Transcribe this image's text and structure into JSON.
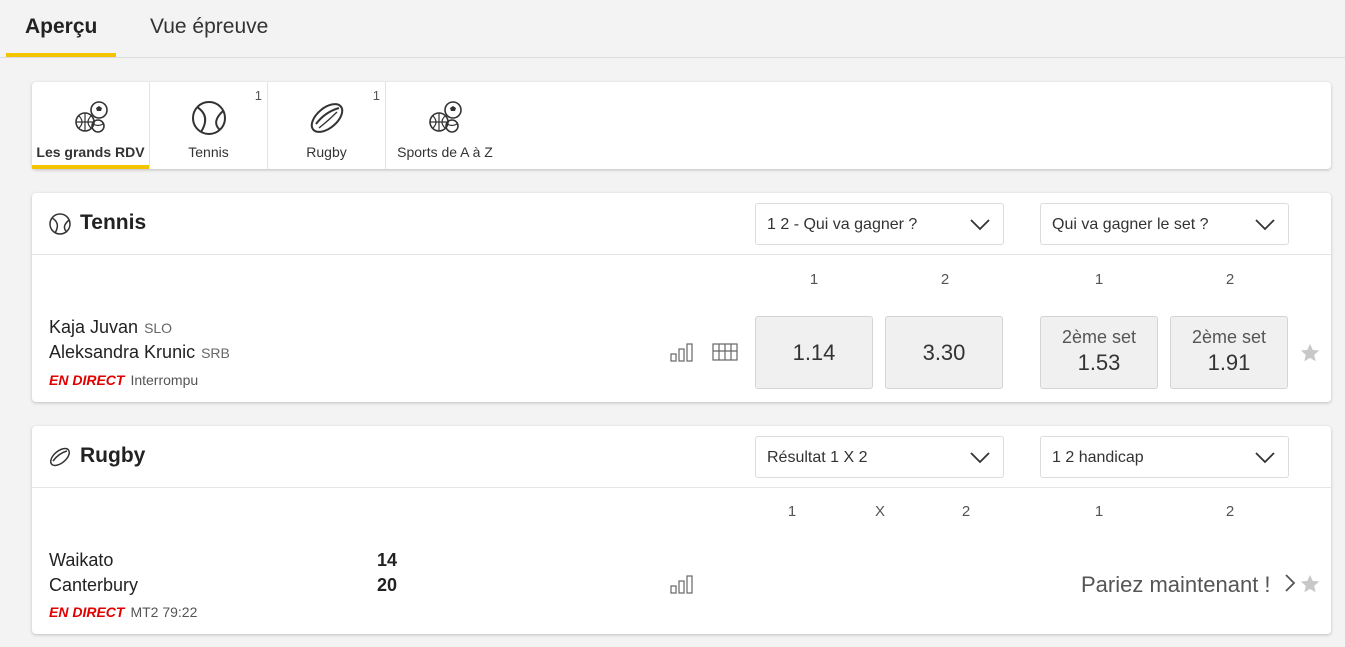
{
  "tabs": [
    {
      "label": "Aperçu",
      "active": true
    },
    {
      "label": "Vue épreuve",
      "active": false
    }
  ],
  "sports_nav": [
    {
      "label": "Les grands RDV",
      "icon": "sports-balls-icon",
      "count": "",
      "active": true
    },
    {
      "label": "Tennis",
      "icon": "tennis-ball-icon",
      "count": "1",
      "active": false
    },
    {
      "label": "Rugby",
      "icon": "rugby-ball-icon",
      "count": "1",
      "active": false
    },
    {
      "label": "Sports de A à Z",
      "icon": "sports-balls-icon",
      "count": "",
      "active": false
    }
  ],
  "colors": {
    "accent": "#f5c400",
    "live": "#e00000",
    "background": "#f3f3f3",
    "odd_bg": "#f0f0f0"
  },
  "tennis": {
    "title": "Tennis",
    "market_a": "1 2 - Qui va gagner ?",
    "market_b": "Qui va gagner le set ?",
    "col_a": [
      "1",
      "2"
    ],
    "col_b": [
      "1",
      "2"
    ],
    "match": {
      "player1": "Kaja Juvan",
      "player1_nat": "SLO",
      "player2": "Aleksandra Krunic",
      "player2_nat": "SRB",
      "live_tag": "EN DIRECT",
      "status": "Interrompu",
      "odds_a": [
        "1.14",
        "3.30"
      ],
      "odds_b_label": "2ème set",
      "odds_b": [
        "1.53",
        "1.91"
      ]
    }
  },
  "rugby": {
    "title": "Rugby",
    "market_a": "Résultat 1 X 2",
    "market_b": "1 2 handicap",
    "col_a": [
      "1",
      "X",
      "2"
    ],
    "col_b": [
      "1",
      "2"
    ],
    "match": {
      "team1": "Waikato",
      "team1_score": "14",
      "team2": "Canterbury",
      "team2_score": "20",
      "live_tag": "EN DIRECT",
      "status": "MT2 79:22",
      "bet_now": "Pariez maintenant !"
    }
  }
}
